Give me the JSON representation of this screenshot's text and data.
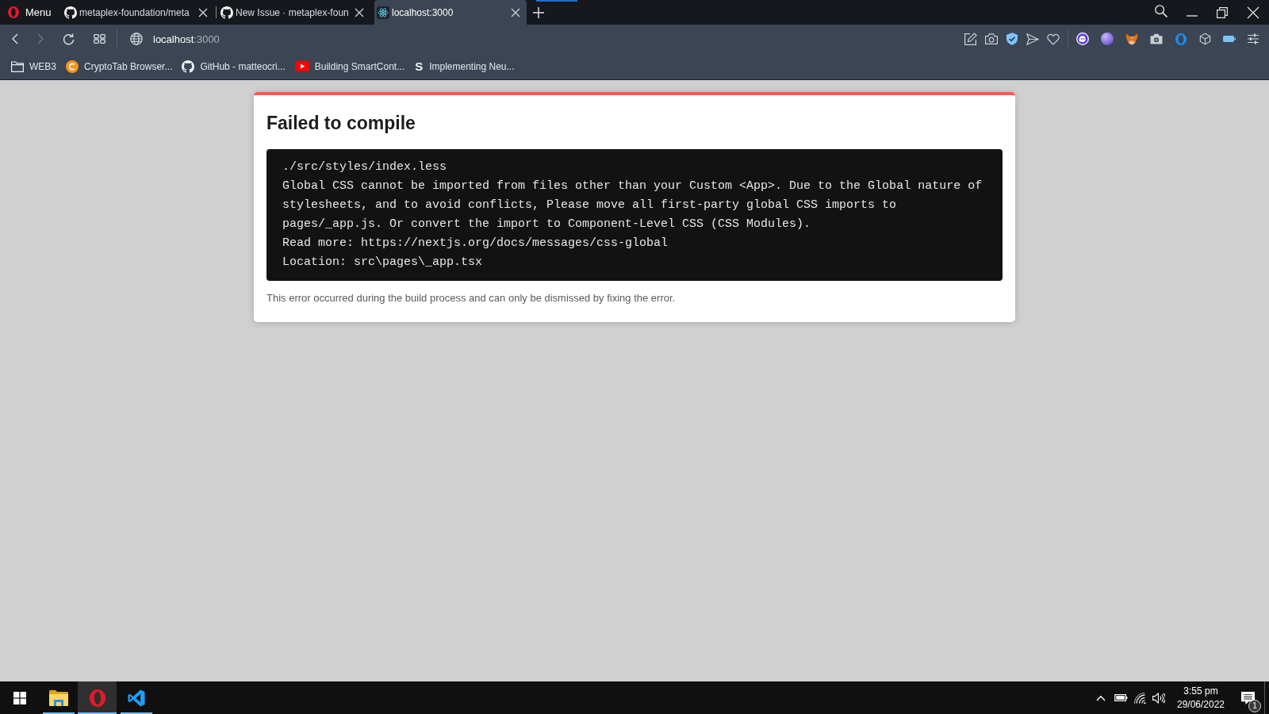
{
  "tab_bar": {
    "menu": {
      "label": "Menu"
    },
    "tabs": [
      {
        "kind": "github",
        "title": "metaplex-foundation/meta",
        "selected": false
      },
      {
        "kind": "github",
        "title": "New Issue · metaplex-foun",
        "selected": false
      },
      {
        "kind": "react",
        "title": "localhost:3000",
        "selected": true
      }
    ]
  },
  "toolbar": {
    "nav_buttons": [
      {
        "kind": "back",
        "disabled": false
      },
      {
        "kind": "forward",
        "disabled": true
      },
      {
        "kind": "reload",
        "disabled": false
      },
      {
        "kind": "tabs",
        "disabled": false
      }
    ],
    "address": {
      "host": "localhost",
      "port": ":3000"
    }
  },
  "bookmarks": [
    {
      "kind": "folder",
      "label": "WEB3"
    },
    {
      "kind": "coin",
      "label": "CryptoTab Browser..."
    },
    {
      "kind": "github",
      "label": "GitHub - matteocri..."
    },
    {
      "kind": "video",
      "label": "Building SmartCont..."
    },
    {
      "kind": "letter",
      "glyph": "S",
      "label": "Implementing Neu..."
    }
  ],
  "error_overlay": {
    "title": "Failed to compile",
    "code": {
      "file": "./src/styles/index.less",
      "message": "Global CSS cannot be imported from files other than your Custom <App>. Due to the Global nature of stylesheets, and to avoid conflicts, Please move all first-party global CSS imports to pages/_app.js. Or convert the import to Component-Level CSS (CSS Modules).",
      "read_more": "Read more: https://nextjs.org/docs/messages/css-global",
      "location": "Location: src\\pages\\_app.tsx"
    },
    "footer": "This error occurred during the build process and can only be dismissed by fixing the error."
  },
  "taskbar": {
    "apps": [
      {
        "kind": "files",
        "selected": false,
        "running": true
      },
      {
        "kind": "opera",
        "selected": true,
        "running": true
      },
      {
        "kind": "editor",
        "selected": false,
        "running": true
      }
    ],
    "clock": {
      "time": "3:55 pm",
      "date": "29/06/2022"
    },
    "notifications": {
      "count": "1"
    }
  }
}
